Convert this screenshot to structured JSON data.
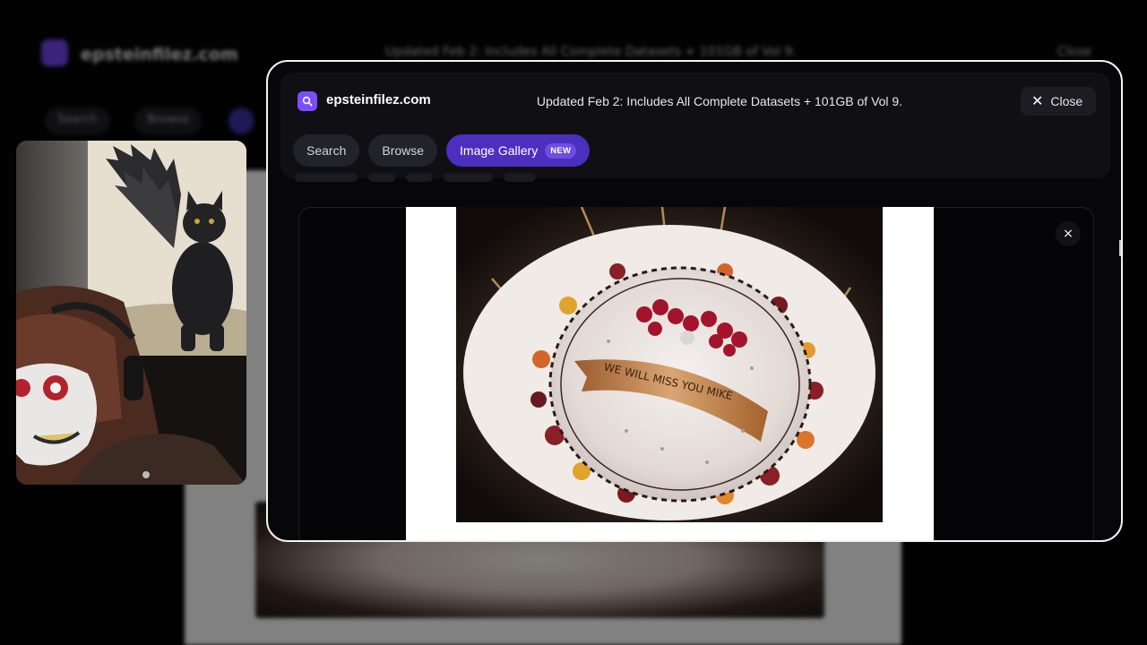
{
  "site": {
    "name": "epsteinfilez.com",
    "banner": "Updated Feb 2: Includes All Complete Datasets + 101GB of Vol 9.",
    "close_label": "Close",
    "accent": "#7c4dff"
  },
  "tabs": [
    {
      "label": "Search",
      "active": false
    },
    {
      "label": "Browse",
      "active": false
    },
    {
      "label": "Image Gallery",
      "active": true,
      "badge": "NEW"
    }
  ],
  "background_page": {
    "tabs": [
      "Search",
      "Browse"
    ]
  },
  "viewer": {
    "close_icon": "×",
    "cake_text": "WE WILL MISS YOU MIKE"
  }
}
